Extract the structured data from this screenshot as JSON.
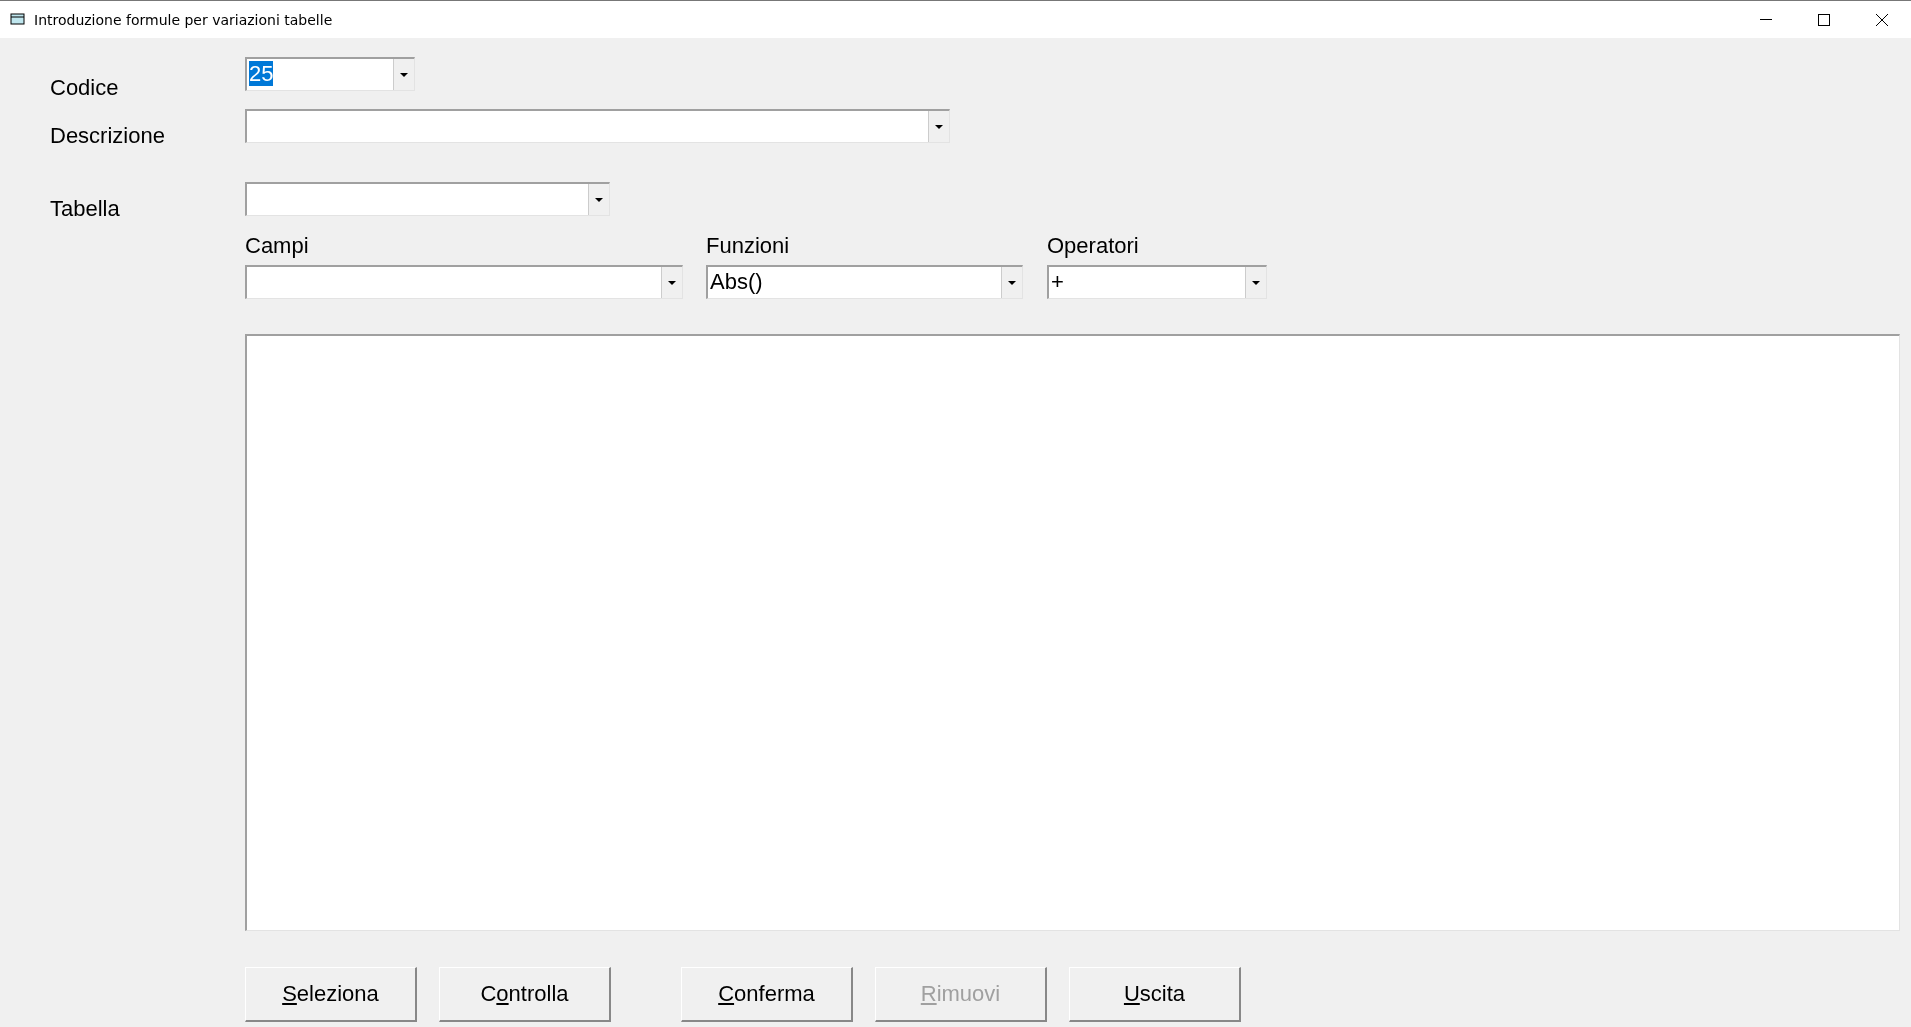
{
  "window": {
    "title": "Introduzione formule per variazioni tabelle"
  },
  "fields": [
    {
      "label": "Codice",
      "value": "25",
      "text_selected": true
    },
    {
      "label": "Descrizione"
    },
    {
      "label": "Tabella"
    }
  ],
  "pickers": [
    {
      "label": "Campi"
    },
    {
      "label": "Funzioni",
      "value": "Abs()"
    },
    {
      "label": "Operatori",
      "value": "+"
    }
  ],
  "buttons": [
    {
      "mnemonic": "S",
      "rest": "eleziona",
      "disabled": false
    },
    {
      "prefix": "C",
      "mnemonic": "o",
      "rest": "ntrolla",
      "disabled": false
    },
    {
      "mnemonic": "C",
      "rest": "onferma",
      "disabled": false
    },
    {
      "mnemonic": "R",
      "rest": "imuovi",
      "disabled": true
    },
    {
      "mnemonic": "U",
      "rest": "scita",
      "disabled": false
    }
  ]
}
